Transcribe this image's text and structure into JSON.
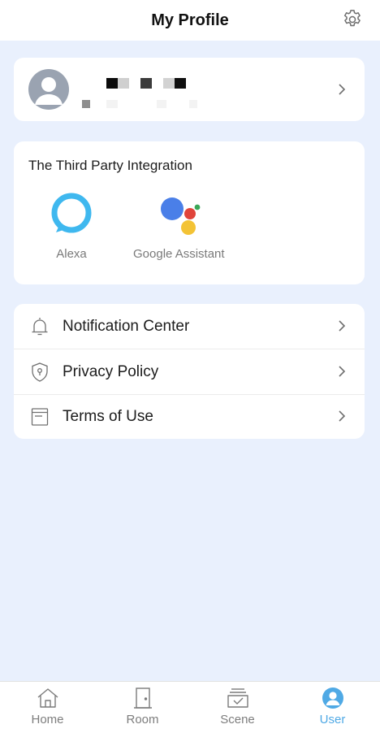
{
  "header": {
    "title": "My Profile",
    "settings_icon": "gear-icon"
  },
  "profile": {
    "avatar_icon": "user-avatar-icon",
    "chevron_icon": "chevron-right-icon"
  },
  "integration": {
    "title": "The Third Party Integration",
    "items": [
      {
        "label": "Alexa",
        "icon": "alexa-icon",
        "color": "#3fb8ef"
      },
      {
        "label": "Google Assistant",
        "icon": "google-assistant-icon",
        "colors": [
          "#4a7fe8",
          "#e0443b",
          "#f3c335",
          "#3aa757"
        ]
      }
    ]
  },
  "menu": {
    "items": [
      {
        "label": "Notification Center",
        "icon": "bell-icon"
      },
      {
        "label": "Privacy Policy",
        "icon": "shield-icon"
      },
      {
        "label": "Terms of Use",
        "icon": "document-icon"
      }
    ]
  },
  "tabbar": {
    "tabs": [
      {
        "label": "Home",
        "icon": "home-icon",
        "active": false
      },
      {
        "label": "Room",
        "icon": "door-icon",
        "active": false
      },
      {
        "label": "Scene",
        "icon": "scene-icon",
        "active": false
      },
      {
        "label": "User",
        "icon": "user-icon",
        "active": true
      }
    ],
    "active_color": "#4fa9e5"
  }
}
